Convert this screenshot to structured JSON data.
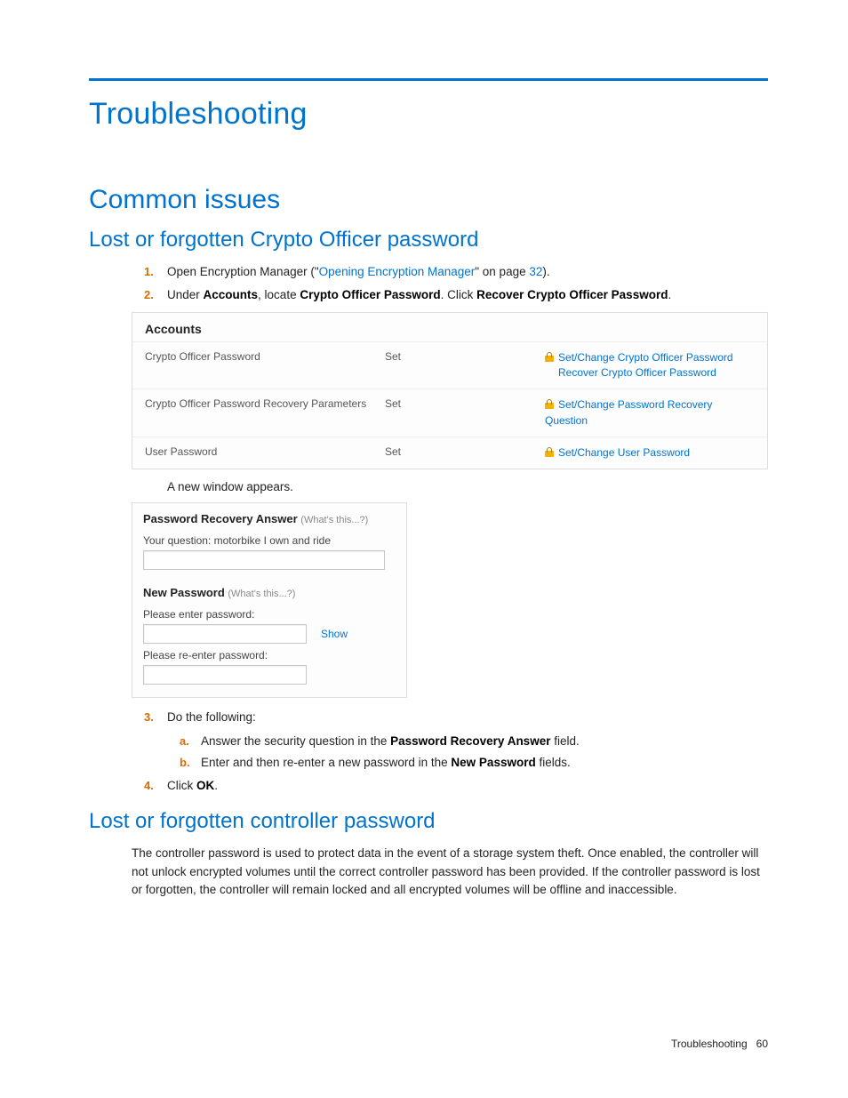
{
  "heading1": "Troubleshooting",
  "heading2": "Common issues",
  "heading3a": "Lost or forgotten Crypto Officer password",
  "heading3b": "Lost or forgotten controller password",
  "steps": {
    "s1_pre": "Open Encryption Manager (\"",
    "s1_link": "Opening Encryption Manager",
    "s1_mid": "\" on page ",
    "s1_page": "32",
    "s1_post": ").",
    "s2_pre": "Under ",
    "s2_b1": "Accounts",
    "s2_mid1": ", locate ",
    "s2_b2": "Crypto Officer Password",
    "s2_mid2": ". Click ",
    "s2_b3": "Recover Crypto Officer Password",
    "s2_post": ".",
    "between": "A new window appears.",
    "s3": "Do the following:",
    "s3a_pre": "Answer the security question in the ",
    "s3a_b": "Password Recovery Answer",
    "s3a_post": " field.",
    "s3b_pre": "Enter and then re-enter a new password in the ",
    "s3b_b": "New Password",
    "s3b_post": " fields.",
    "s4_pre": "Click ",
    "s4_b": "OK",
    "s4_post": "."
  },
  "accounts": {
    "title": "Accounts",
    "rows": [
      {
        "name": "Crypto Officer Password",
        "status": "Set",
        "actions": [
          "Set/Change Crypto Officer Password",
          "Recover Crypto Officer Password"
        ]
      },
      {
        "name": "Crypto Officer Password Recovery Parameters",
        "status": "Set",
        "actions": [
          "Set/Change Password Recovery Question"
        ]
      },
      {
        "name": "User Password",
        "status": "Set",
        "actions": [
          "Set/Change User Password"
        ]
      }
    ]
  },
  "recovery": {
    "head1": "Password Recovery Answer",
    "whats": "(What's this...?)",
    "question_label": "Your question: motorbike I own and ride",
    "head2": "New Password",
    "enter_label": "Please enter password:",
    "show": "Show",
    "reenter_label": "Please re-enter password:"
  },
  "controller_para": "The controller password is used to protect data in the event of a storage system theft. Once enabled, the controller will not unlock encrypted volumes until the correct controller password has been provided. If the controller password is lost or forgotten, the controller will remain locked and all encrypted volumes will be offline and inaccessible.",
  "footer_label": "Troubleshooting",
  "footer_page": "60"
}
